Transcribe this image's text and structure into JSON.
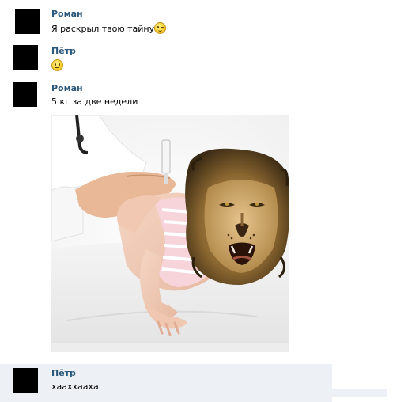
{
  "messages": [
    {
      "author": "Роман",
      "text": "Я раскрыл твою тайну",
      "emoji": "winking-smiley-icon"
    },
    {
      "author": "Пётр",
      "text": "",
      "emoji": "neutral-smiley-icon"
    },
    {
      "author": "Роман",
      "text": "5 кг за две недели",
      "attachment": "photo-baby-injection-with-lion-head"
    },
    {
      "author": "Пётр",
      "text": "хааххааха"
    }
  ],
  "colors": {
    "author_name": "#2b587a",
    "message_text": "#000000",
    "avatar": "#000000",
    "highlight_row": "#edf1f5"
  }
}
